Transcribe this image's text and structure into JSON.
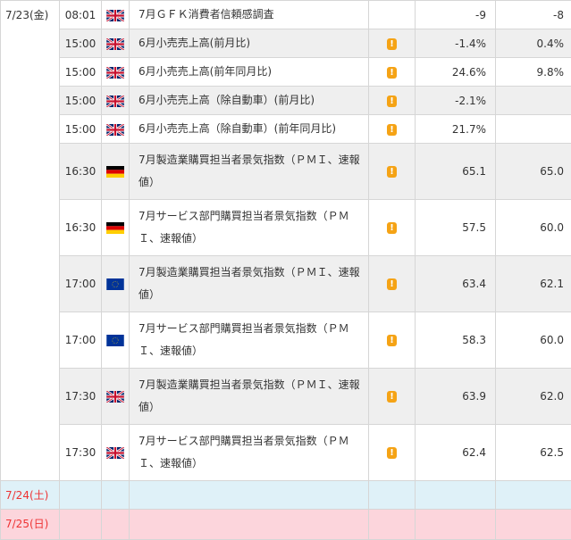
{
  "days": [
    {
      "date": "7/23(金)"
    },
    {
      "date": "7/24(土)"
    },
    {
      "date": "7/25(日)"
    }
  ],
  "events": [
    {
      "time": "08:01",
      "country": "uk-flag-icon",
      "name": "7月ＧＦＫ消費者信頼感調査",
      "important": false,
      "previous": "-9",
      "forecast": "-8"
    },
    {
      "time": "15:00",
      "country": "uk-flag-icon",
      "name": "6月小売売上高(前月比)",
      "important": true,
      "previous": "-1.4%",
      "forecast": "0.4%"
    },
    {
      "time": "15:00",
      "country": "uk-flag-icon",
      "name": "6月小売売上高(前年同月比)",
      "important": true,
      "previous": "24.6%",
      "forecast": "9.8%"
    },
    {
      "time": "15:00",
      "country": "uk-flag-icon",
      "name": "6月小売売上高（除自動車）(前月比)",
      "important": true,
      "previous": "-2.1%",
      "forecast": ""
    },
    {
      "time": "15:00",
      "country": "uk-flag-icon",
      "name": "6月小売売上高（除自動車）(前年同月比)",
      "important": true,
      "previous": "21.7%",
      "forecast": ""
    },
    {
      "time": "16:30",
      "country": "germany-flag-icon",
      "name": "7月製造業購買担当者景気指数（ＰＭＩ、速報値）",
      "important": true,
      "previous": "65.1",
      "forecast": "65.0"
    },
    {
      "time": "16:30",
      "country": "germany-flag-icon",
      "name": "7月サービス部門購買担当者景気指数（ＰＭＩ、速報値）",
      "important": true,
      "previous": "57.5",
      "forecast": "60.0"
    },
    {
      "time": "17:00",
      "country": "eu-flag-icon",
      "name": "7月製造業購買担当者景気指数（ＰＭＩ、速報値）",
      "important": true,
      "previous": "63.4",
      "forecast": "62.1"
    },
    {
      "time": "17:00",
      "country": "eu-flag-icon",
      "name": "7月サービス部門購買担当者景気指数（ＰＭＩ、速報値）",
      "important": true,
      "previous": "58.3",
      "forecast": "60.0"
    },
    {
      "time": "17:30",
      "country": "uk-flag-icon",
      "name": "7月製造業購買担当者景気指数（ＰＭＩ、速報値）",
      "important": true,
      "previous": "63.9",
      "forecast": "62.0"
    },
    {
      "time": "17:30",
      "country": "uk-flag-icon",
      "name": "7月サービス部門購買担当者景気指数（ＰＭＩ、速報値）",
      "important": true,
      "previous": "62.4",
      "forecast": "62.5"
    }
  ],
  "colors": {
    "alt_row": "#efefef",
    "saturday_row": "#dff1f8",
    "sunday_row": "#fcd5dc",
    "weekend_date_text": "#e33333",
    "importance_badge": "#f5a315"
  },
  "importance_icon": "exclamation-badge-icon",
  "importance_glyph": "!"
}
